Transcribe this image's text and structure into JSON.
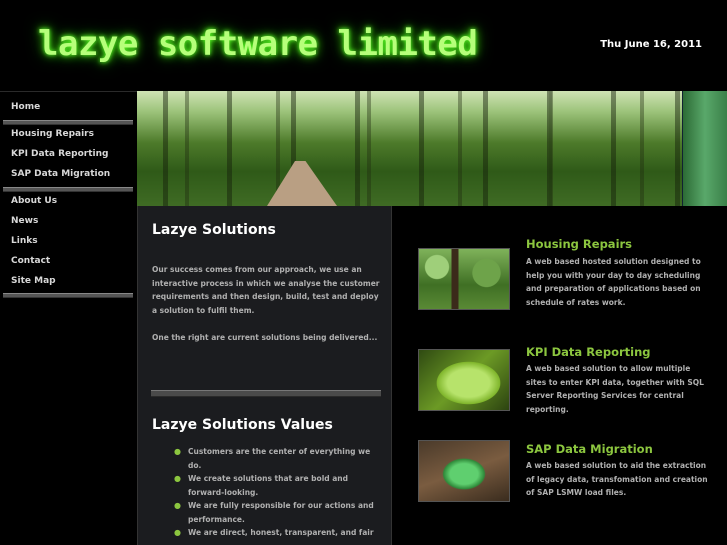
{
  "header": {
    "logo_text": "lazye software limited",
    "date": "Thu June 16, 2011"
  },
  "nav": {
    "items": [
      {
        "label": "Home"
      },
      {
        "label": "Housing Repairs"
      },
      {
        "label": "KPI Data Reporting"
      },
      {
        "label": "SAP Data Migration"
      },
      {
        "label": "About Us"
      },
      {
        "label": "News"
      },
      {
        "label": "Links"
      },
      {
        "label": "Contact"
      },
      {
        "label": "Site Map"
      }
    ]
  },
  "intro": {
    "title": "Lazye Solutions",
    "paragraph1": "Our success comes from our approach, we use an interactive process in which we analyse the customer requirements and then design, build, test and deploy a solution to fulfil them.",
    "paragraph2": "One the right are current solutions being delivered..."
  },
  "values": {
    "title": "Lazye Solutions Values",
    "items": [
      "Customers are the center of everything we do.",
      "We create solutions that are bold and forward-looking.",
      "We are fully responsible for our actions and performance.",
      "We are direct, honest, transparent, and fair"
    ]
  },
  "solutions": [
    {
      "title": "Housing Repairs",
      "description": "A web based hosted solution designed to help you with your day to day scheduling and preparation of applications based on schedule of rates work."
    },
    {
      "title": "KPI Data Reporting",
      "description": "A web based solution to allow multiple sites to enter KPI data, together with SQL Server Reporting Services for central reporting."
    },
    {
      "title": "SAP Data Migration",
      "description": "A web based solution to aid the extraction of legacy data, transfomation and creation of SAP LSMW load files."
    }
  ],
  "colors": {
    "accent_green": "#8cc63f",
    "logo_glow": "#5fff2a",
    "panel_bg": "#1b1c1f"
  }
}
